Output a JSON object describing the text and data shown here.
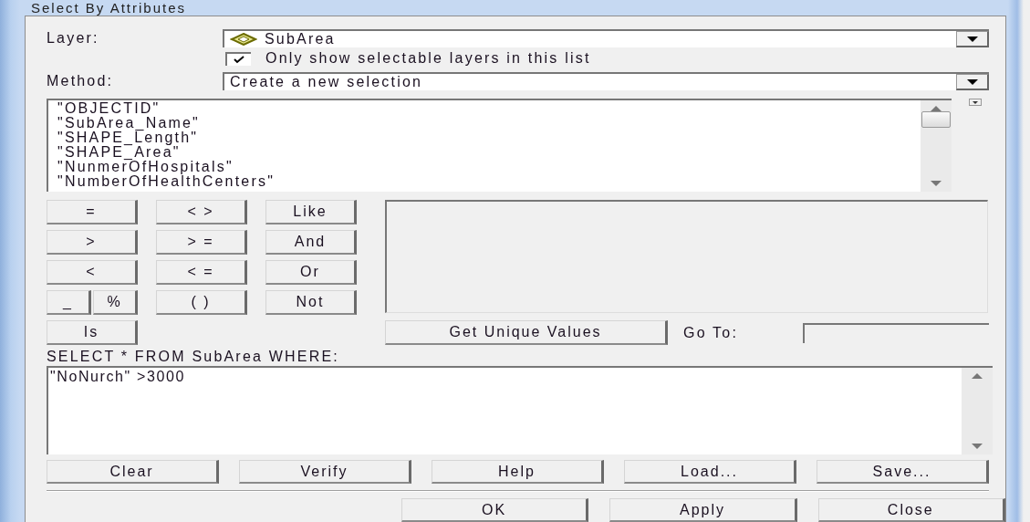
{
  "window": {
    "title": "Select By Attributes"
  },
  "layer": {
    "label": "Layer:",
    "value": "SubArea"
  },
  "selectable_only": {
    "label": "Only show selectable layers in this list",
    "checked": true
  },
  "method": {
    "label": "Method:",
    "value": "Create a new selection"
  },
  "fields": [
    "\"OBJECTID\"",
    "\"SubArea_Name\"",
    "\"SHAPE_Length\"",
    "\"SHAPE_Area\"",
    "\"NunmerOfHospitals\"",
    "\"NumberOfHealthCenters\""
  ],
  "operators": [
    [
      "=",
      "< >",
      "Like"
    ],
    [
      ">",
      "> =",
      "And"
    ],
    [
      "<",
      "< =",
      "Or"
    ],
    [
      "_",
      "%",
      "( )",
      "Not"
    ],
    [
      "Is"
    ]
  ],
  "unique_values": {
    "button": "Get Unique Values",
    "goto_label": "Go To:"
  },
  "query": {
    "label": "SELECT * FROM SubArea WHERE:",
    "value": "\"NoNurch\" >3000"
  },
  "query_buttons": [
    "Clear",
    "Verify",
    "Help",
    "Load...",
    "Save..."
  ],
  "dialog_buttons": [
    "OK",
    "Apply",
    "Close"
  ]
}
